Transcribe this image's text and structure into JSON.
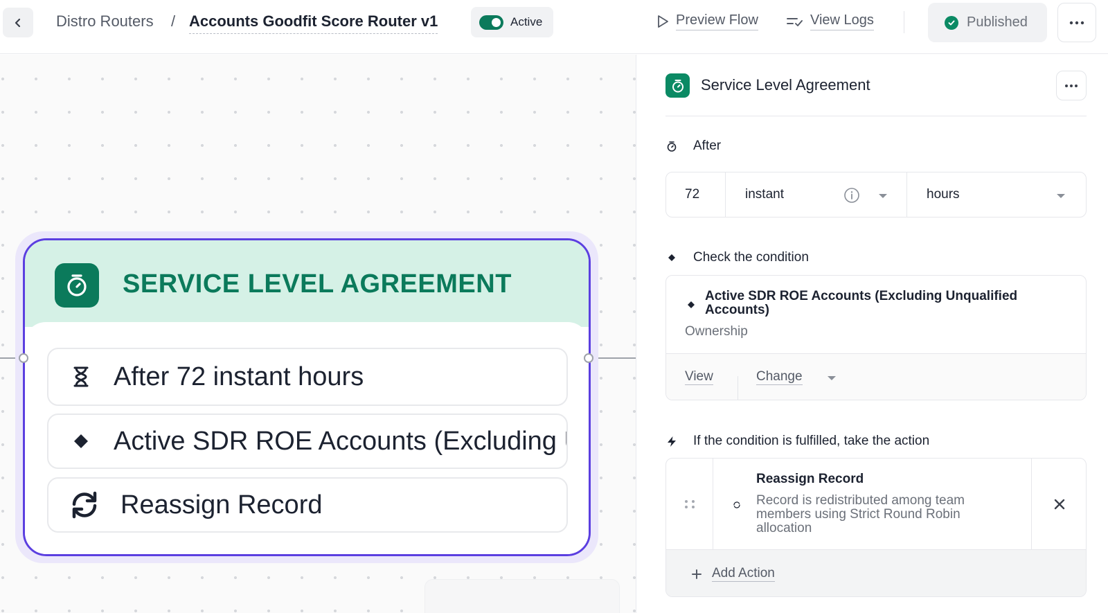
{
  "topbar": {
    "back_icon": "chevron-left-icon",
    "breadcrumb_parent": "Distro Routers",
    "breadcrumb_separator": "/",
    "breadcrumb_current": "Accounts Goodfit Score Router v1",
    "active_label": "Active",
    "active_on": true,
    "preview_flow_label": "Preview Flow",
    "view_logs_label": "View Logs",
    "published_label": "Published"
  },
  "canvas": {
    "node": {
      "title": "SERVICE LEVEL AGREEMENT",
      "rows": [
        {
          "icon": "hourglass-icon",
          "text": "After 72 instant hours"
        },
        {
          "icon": "diamond-icon",
          "text": "Active SDR ROE Accounts (Excluding Unqualified Accounts)"
        },
        {
          "icon": "refresh-icon",
          "text": "Reassign Record"
        }
      ]
    }
  },
  "panel": {
    "title": "Service Level Agreement",
    "after": {
      "label": "After",
      "amount": "72",
      "type": "instant",
      "unit": "hours"
    },
    "condition": {
      "label": "Check the condition",
      "name": "Active SDR ROE Accounts (Excluding Unqualified Accounts)",
      "subtitle": "Ownership",
      "view_label": "View",
      "change_label": "Change"
    },
    "action": {
      "label": "If the condition is fulfilled, take the action",
      "title": "Reassign Record",
      "description": "Record is redistributed among team members using Strict Round Robin allocation",
      "add_label": "Add Action"
    }
  },
  "colors": {
    "brand_green": "#0b7a5b",
    "node_header_bg": "#d5f1e6",
    "node_border": "#5b3fe0",
    "node_halo": "#ebe7fb"
  }
}
